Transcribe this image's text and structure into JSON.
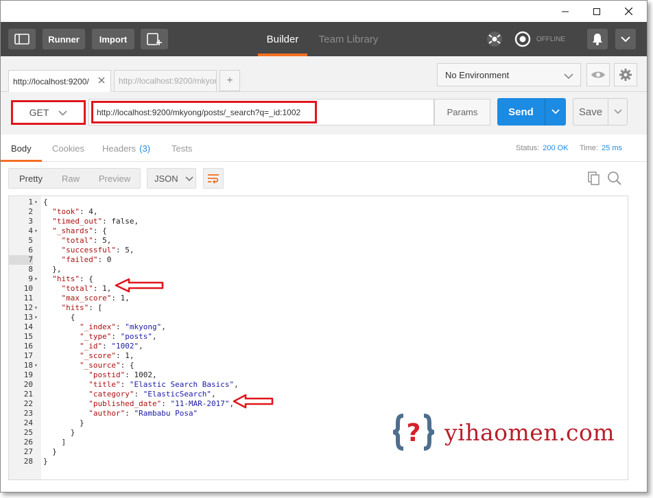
{
  "window": {
    "minimize_icon": "minimize-icon",
    "maximize_icon": "maximize-icon",
    "close_icon": "close-icon"
  },
  "header": {
    "runner_label": "Runner",
    "import_label": "Import",
    "builder_label": "Builder",
    "team_library_label": "Team Library",
    "offline_label": "OFFLINE"
  },
  "tabs": [
    {
      "label": "http://localhost:9200/"
    },
    {
      "label": "http://localhost:9200/mkyor"
    }
  ],
  "environment": {
    "selected": "No Environment"
  },
  "request": {
    "method": "GET",
    "url": "http://localhost:9200/mkyong/posts/_search?q=_id:1002",
    "params_label": "Params",
    "send_label": "Send",
    "save_label": "Save"
  },
  "response_tabs": {
    "body": "Body",
    "cookies": "Cookies",
    "headers": "Headers",
    "headers_count": "(3)",
    "tests": "Tests"
  },
  "response_status": {
    "status_label": "Status:",
    "status_value": "200 OK",
    "time_label": "Time:",
    "time_value": "25 ms"
  },
  "view": {
    "pretty": "Pretty",
    "raw": "Raw",
    "preview": "Preview",
    "format": "JSON"
  },
  "code_lines": [
    {
      "n": "1",
      "fold": true,
      "indent": 0,
      "t": [
        [
          "p",
          "{"
        ]
      ]
    },
    {
      "n": "2",
      "fold": false,
      "indent": 1,
      "t": [
        [
          "k",
          "\"took\""
        ],
        [
          "p",
          ": "
        ],
        [
          "n",
          "4"
        ],
        [
          "p",
          ","
        ]
      ]
    },
    {
      "n": "3",
      "fold": false,
      "indent": 1,
      "t": [
        [
          "k",
          "\"timed_out\""
        ],
        [
          "p",
          ": "
        ],
        [
          "n",
          "false"
        ],
        [
          "p",
          ","
        ]
      ]
    },
    {
      "n": "4",
      "fold": true,
      "indent": 1,
      "t": [
        [
          "k",
          "\"_shards\""
        ],
        [
          "p",
          ": {"
        ]
      ]
    },
    {
      "n": "5",
      "fold": false,
      "indent": 2,
      "t": [
        [
          "k",
          "\"total\""
        ],
        [
          "p",
          ": "
        ],
        [
          "n",
          "5"
        ],
        [
          "p",
          ","
        ]
      ]
    },
    {
      "n": "6",
      "fold": false,
      "indent": 2,
      "t": [
        [
          "k",
          "\"successful\""
        ],
        [
          "p",
          ": "
        ],
        [
          "n",
          "5"
        ],
        [
          "p",
          ","
        ]
      ]
    },
    {
      "n": "7",
      "fold": false,
      "indent": 2,
      "hl": true,
      "t": [
        [
          "k",
          "\"failed\""
        ],
        [
          "p",
          ": "
        ],
        [
          "n",
          "0"
        ]
      ]
    },
    {
      "n": "8",
      "fold": false,
      "indent": 1,
      "t": [
        [
          "p",
          "},"
        ]
      ]
    },
    {
      "n": "9",
      "fold": true,
      "indent": 1,
      "t": [
        [
          "k",
          "\"hits\""
        ],
        [
          "p",
          ": {"
        ]
      ]
    },
    {
      "n": "10",
      "fold": false,
      "indent": 2,
      "t": [
        [
          "k",
          "\"total\""
        ],
        [
          "p",
          ": "
        ],
        [
          "n",
          "1"
        ],
        [
          "p",
          ","
        ]
      ]
    },
    {
      "n": "11",
      "fold": false,
      "indent": 2,
      "t": [
        [
          "k",
          "\"max_score\""
        ],
        [
          "p",
          ": "
        ],
        [
          "n",
          "1"
        ],
        [
          "p",
          ","
        ]
      ]
    },
    {
      "n": "12",
      "fold": true,
      "indent": 2,
      "t": [
        [
          "k",
          "\"hits\""
        ],
        [
          "p",
          ": ["
        ]
      ]
    },
    {
      "n": "13",
      "fold": true,
      "indent": 3,
      "t": [
        [
          "p",
          "{"
        ]
      ]
    },
    {
      "n": "14",
      "fold": false,
      "indent": 4,
      "t": [
        [
          "k",
          "\"_index\""
        ],
        [
          "p",
          ": "
        ],
        [
          "s",
          "\"mkyong\""
        ],
        [
          "p",
          ","
        ]
      ]
    },
    {
      "n": "15",
      "fold": false,
      "indent": 4,
      "t": [
        [
          "k",
          "\"_type\""
        ],
        [
          "p",
          ": "
        ],
        [
          "s",
          "\"posts\""
        ],
        [
          "p",
          ","
        ]
      ]
    },
    {
      "n": "16",
      "fold": false,
      "indent": 4,
      "t": [
        [
          "k",
          "\"_id\""
        ],
        [
          "p",
          ": "
        ],
        [
          "s",
          "\"1002\""
        ],
        [
          "p",
          ","
        ]
      ]
    },
    {
      "n": "17",
      "fold": false,
      "indent": 4,
      "t": [
        [
          "k",
          "\"_score\""
        ],
        [
          "p",
          ": "
        ],
        [
          "n",
          "1"
        ],
        [
          "p",
          ","
        ]
      ]
    },
    {
      "n": "18",
      "fold": true,
      "indent": 4,
      "t": [
        [
          "k",
          "\"_source\""
        ],
        [
          "p",
          ": {"
        ]
      ]
    },
    {
      "n": "19",
      "fold": false,
      "indent": 5,
      "t": [
        [
          "k",
          "\"postid\""
        ],
        [
          "p",
          ": "
        ],
        [
          "n",
          "1002"
        ],
        [
          "p",
          ","
        ]
      ]
    },
    {
      "n": "20",
      "fold": false,
      "indent": 5,
      "t": [
        [
          "k",
          "\"title\""
        ],
        [
          "p",
          ": "
        ],
        [
          "s",
          "\"Elastic Search Basics\""
        ],
        [
          "p",
          ","
        ]
      ]
    },
    {
      "n": "21",
      "fold": false,
      "indent": 5,
      "t": [
        [
          "k",
          "\"category\""
        ],
        [
          "p",
          ": "
        ],
        [
          "s",
          "\"ElasticSearch\""
        ],
        [
          "p",
          ","
        ]
      ]
    },
    {
      "n": "22",
      "fold": false,
      "indent": 5,
      "t": [
        [
          "k",
          "\"published_date\""
        ],
        [
          "p",
          ": "
        ],
        [
          "s",
          "\"11-MAR-2017\""
        ],
        [
          "p",
          ","
        ]
      ]
    },
    {
      "n": "23",
      "fold": false,
      "indent": 5,
      "t": [
        [
          "k",
          "\"author\""
        ],
        [
          "p",
          ": "
        ],
        [
          "s",
          "\"Rambabu Posa\""
        ]
      ]
    },
    {
      "n": "24",
      "fold": false,
      "indent": 4,
      "t": [
        [
          "p",
          "}"
        ]
      ]
    },
    {
      "n": "25",
      "fold": false,
      "indent": 3,
      "t": [
        [
          "p",
          "}"
        ]
      ]
    },
    {
      "n": "26",
      "fold": false,
      "indent": 2,
      "t": [
        [
          "p",
          "]"
        ]
      ]
    },
    {
      "n": "27",
      "fold": false,
      "indent": 1,
      "t": [
        [
          "p",
          "}"
        ]
      ]
    },
    {
      "n": "28",
      "fold": false,
      "indent": 0,
      "t": [
        [
          "p",
          "}"
        ]
      ]
    }
  ],
  "watermark": {
    "text": "yihaomen.com",
    "logo_glyph": "?"
  },
  "colors": {
    "accent": "#f47023",
    "send": "#1b8be3",
    "highlight": "#e0161e",
    "header_bg": "#464646"
  }
}
